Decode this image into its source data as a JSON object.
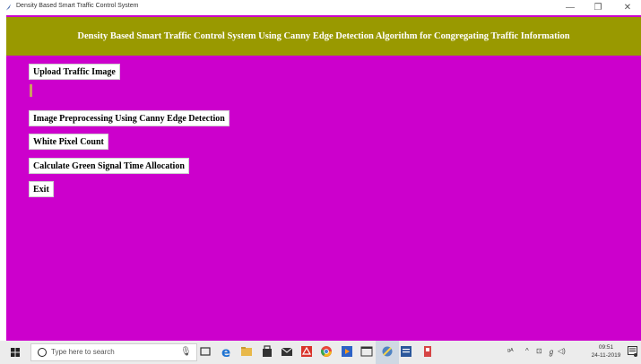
{
  "window": {
    "title": "Density Based Smart Traffic Control System",
    "minimize_glyph": "—",
    "maximize_glyph": "❐",
    "close_glyph": "✕"
  },
  "header": {
    "title": "Density Based Smart Traffic Control System Using Canny Edge Detection Algorithm for Congregating Traffic Information"
  },
  "buttons": {
    "upload": "Upload Traffic Image",
    "preprocess": "Image Preprocessing Using Canny Edge Detection",
    "pixel_count": "White Pixel Count",
    "green_time": "Calculate Green Signal Time Allocation",
    "exit": "Exit"
  },
  "taskbar": {
    "search_placeholder": "Type here to search",
    "time": "09:51",
    "date": "24-11-2019"
  },
  "colors": {
    "background": "#cc00cc",
    "header": "#999900",
    "header_text": "#ffffff",
    "button": "#ffffff"
  }
}
